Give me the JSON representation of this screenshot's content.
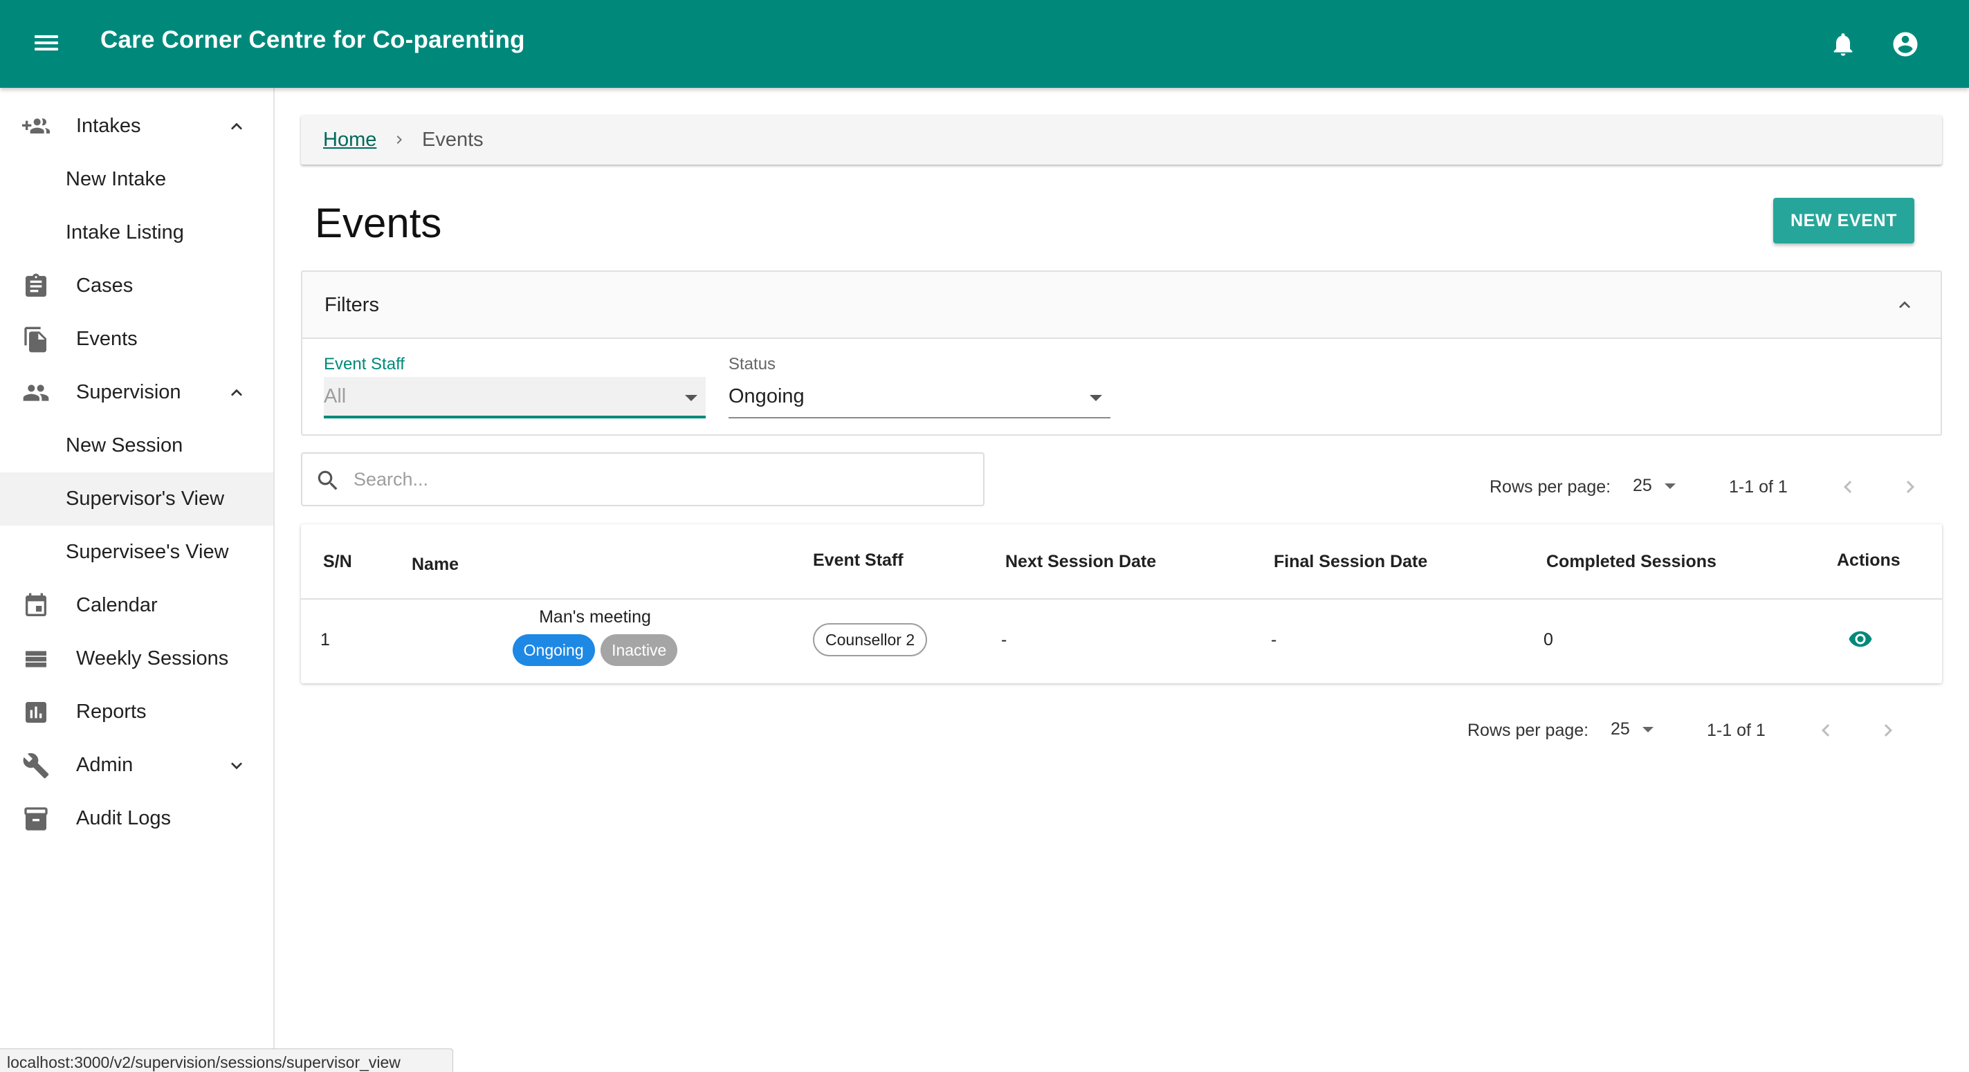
{
  "app": {
    "title": "Care Corner Centre for Co-parenting"
  },
  "sidebar": {
    "items": [
      {
        "label": "Intakes",
        "icon": "add-group-icon",
        "expanded": true
      },
      {
        "label": "New Intake"
      },
      {
        "label": "Intake Listing"
      },
      {
        "label": "Cases",
        "icon": "clipboard-icon"
      },
      {
        "label": "Events",
        "icon": "file-copy-icon"
      },
      {
        "label": "Supervision",
        "icon": "people-icon",
        "expanded": true
      },
      {
        "label": "New Session"
      },
      {
        "label": "Supervisor's View",
        "active": true
      },
      {
        "label": "Supervisee's View"
      },
      {
        "label": "Calendar",
        "icon": "calendar-icon"
      },
      {
        "label": "Weekly Sessions",
        "icon": "view-list-icon"
      },
      {
        "label": "Reports",
        "icon": "bar-chart-icon"
      },
      {
        "label": "Admin",
        "icon": "wrench-icon",
        "expanded": false
      },
      {
        "label": "Audit Logs",
        "icon": "archive-icon"
      }
    ]
  },
  "breadcrumb": {
    "home": "Home",
    "current": "Events"
  },
  "page": {
    "title": "Events",
    "new_button": "NEW EVENT"
  },
  "filters": {
    "title": "Filters",
    "event_staff": {
      "label": "Event Staff",
      "value": "All"
    },
    "status": {
      "label": "Status",
      "value": "Ongoing"
    }
  },
  "search": {
    "placeholder": "Search..."
  },
  "pagination": {
    "rows_label": "Rows per page:",
    "rows_value": "25",
    "range": "1-1 of 1"
  },
  "table": {
    "headers": {
      "sn": "S/N",
      "name": "Name",
      "event_staff": "Event Staff",
      "next_session": "Next Session Date",
      "final_session": "Final Session Date",
      "completed": "Completed Sessions",
      "actions": "Actions"
    },
    "rows": [
      {
        "sn": "1",
        "name": "Man's meeting",
        "status_chip": "Ongoing",
        "state_chip": "Inactive",
        "event_staff": "Counsellor 2",
        "next_session": "-",
        "final_session": "-",
        "completed": "0"
      }
    ]
  },
  "status_bar": {
    "url": "localhost:3000/v2/supervision/sessions/supervisor_view"
  },
  "colors": {
    "primary": "#00897b",
    "button": "#26a69a",
    "chip_ongoing": "#1e88e5",
    "chip_inactive": "#a5a5a5"
  }
}
